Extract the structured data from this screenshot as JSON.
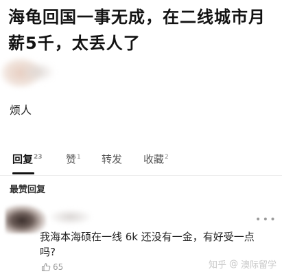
{
  "post": {
    "title": "海龟回国一事无成，在二线城市月薪5千，太丢人了",
    "body": "烦人"
  },
  "tabs": [
    {
      "label": "回复",
      "count": "23"
    },
    {
      "label": "赞",
      "count": "1"
    },
    {
      "label": "转发",
      "count": ""
    },
    {
      "label": "收藏",
      "count": "2"
    }
  ],
  "section": {
    "label": "最赞回复"
  },
  "reply": {
    "text": "我海本海硕在一线 6k 还没有一金，有好受一点吗?",
    "likes": "65",
    "more_icon": "more-horizontal-icon"
  },
  "watermark": {
    "text1": "知乎",
    "text2": "澳际留学"
  }
}
